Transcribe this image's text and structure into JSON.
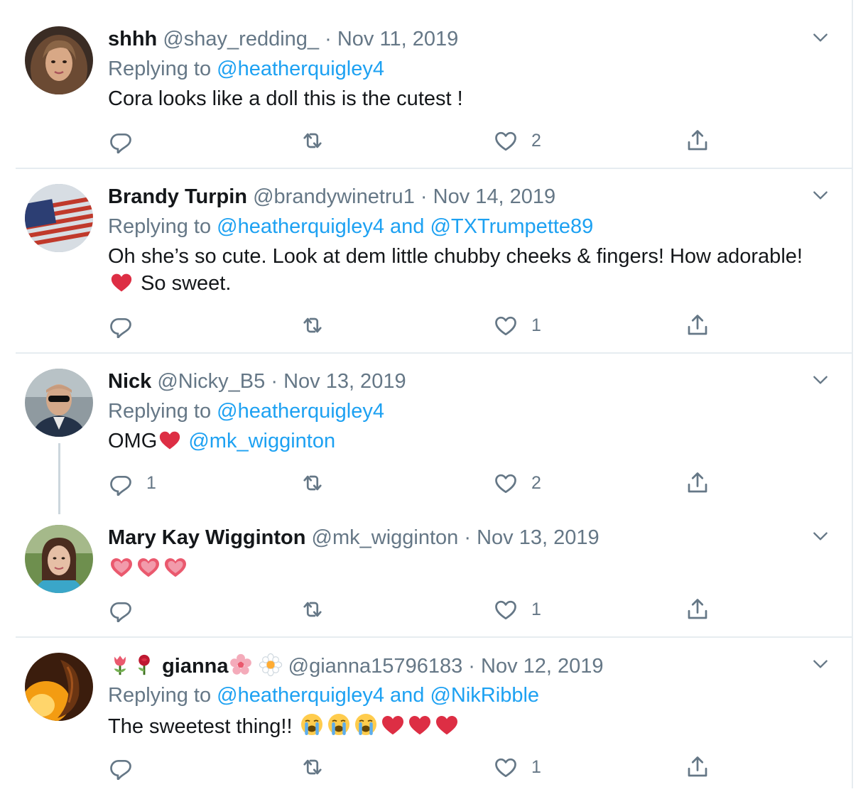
{
  "tweets": [
    {
      "name": "shhh",
      "handle": "@shay_redding_",
      "separator": "·",
      "date": "Nov 11, 2019",
      "replying_prefix": "Replying to",
      "replying_to": "@heatherquigley4",
      "text": "Cora looks like a doll this is the cutest !",
      "reply_count": "",
      "retweet_count": "",
      "like_count": "2"
    },
    {
      "name": "Brandy Turpin",
      "handle": "@brandywinetru1",
      "separator": "·",
      "date": "Nov 14, 2019",
      "replying_prefix": "Replying to",
      "replying_to": "@heatherquigley4 and @TXTrumpette89",
      "text_line1": "Oh she’s so cute. Look at dem little chubby cheeks & fingers! How adorable!",
      "text_line2": "So sweet.",
      "reply_count": "",
      "retweet_count": "",
      "like_count": "1"
    },
    {
      "name": "Nick",
      "handle": "@Nicky_B5",
      "separator": "·",
      "date": "Nov 13, 2019",
      "replying_prefix": "Replying to",
      "replying_to": "@heatherquigley4",
      "text": "OMG",
      "mention": "@mk_wigginton",
      "reply_count": "1",
      "retweet_count": "",
      "like_count": "2"
    },
    {
      "name": "Mary Kay Wigginton",
      "handle": "@mk_wigginton",
      "separator": "·",
      "date": "Nov 13, 2019",
      "reply_count": "",
      "retweet_count": "",
      "like_count": "1"
    },
    {
      "name": "gianna",
      "handle": "@gianna15796183",
      "separator": "·",
      "date": "Nov 12, 2019",
      "replying_prefix": "Replying to",
      "replying_to": "@heatherquigley4 and @NikRibble",
      "text": "The sweetest thing!!",
      "reply_count": "",
      "retweet_count": "",
      "like_count": "1"
    }
  ],
  "icons": {
    "reply": "reply-icon",
    "retweet": "retweet-icon",
    "like": "heart-icon",
    "share": "share-icon",
    "more": "chevron-down-icon"
  },
  "colors": {
    "link": "#1da1f2",
    "secondary_text": "#657786",
    "emoji_heart": "#e0245e",
    "divider": "#e6ecf0"
  }
}
